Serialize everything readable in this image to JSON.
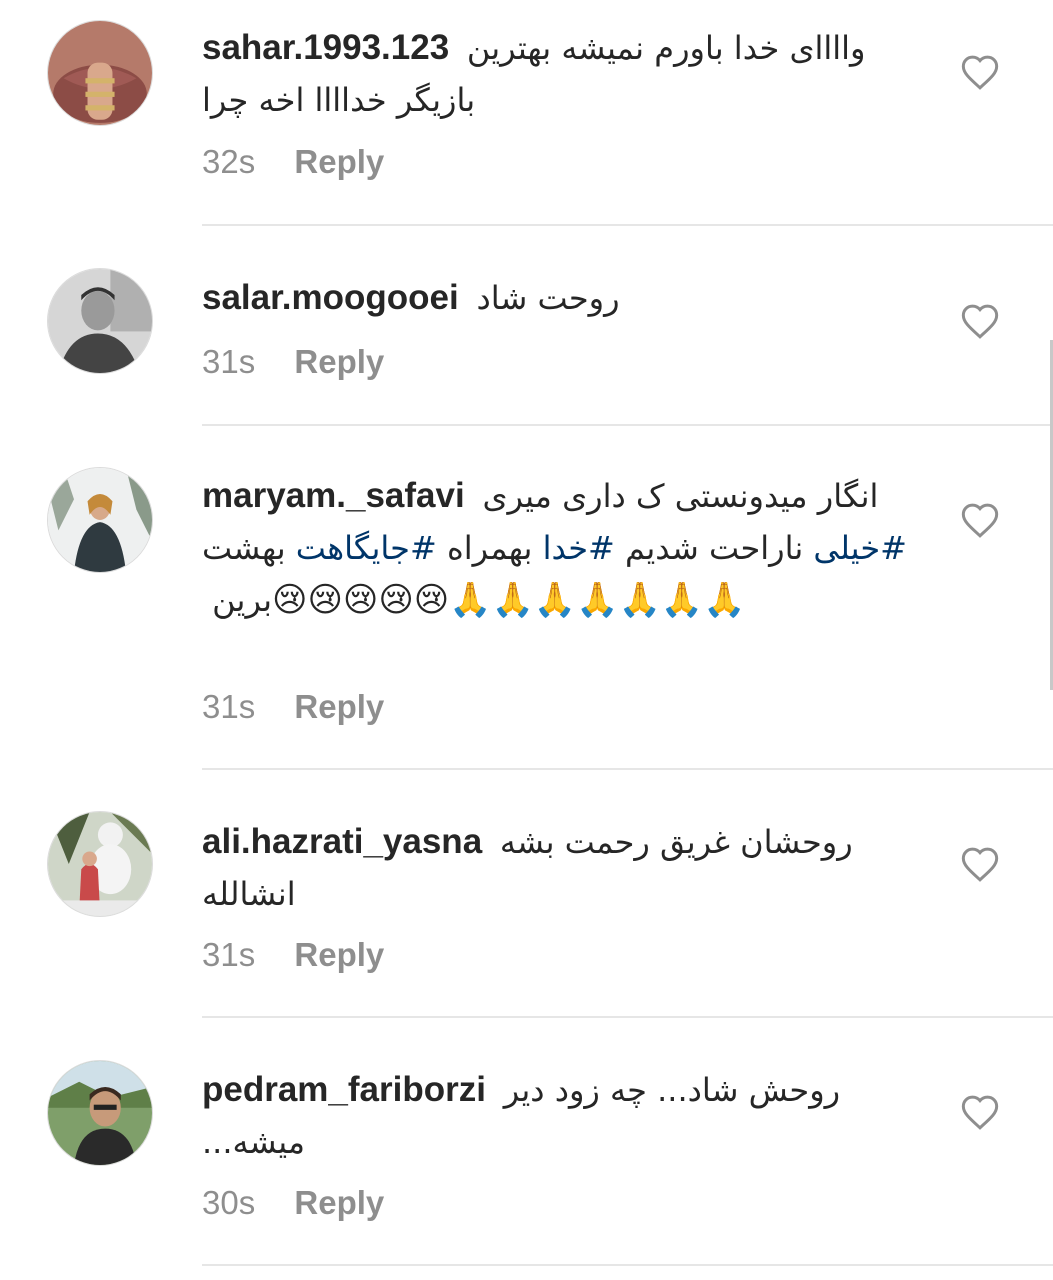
{
  "comments": [
    {
      "username": "sahar.1993.123",
      "text": "واااای خدا باورم نمیشه بهترین بازیگر خداااا اخه چرا",
      "time": "32s",
      "reply_label": "Reply"
    },
    {
      "username": "salar.moogooei",
      "text": "روحت شاد",
      "time": "31s",
      "reply_label": "Reply"
    },
    {
      "username": "maryam._safavi",
      "text_part1": "انگار میدونستی ک داری میری",
      "hashtag1": "#خیلی",
      "text_part2": "ناراحت شدیم",
      "hashtag2": "#خدا",
      "text_part3": "بهمراه",
      "hashtag3": "#جایگاهت",
      "text_part4": "بهشت برین",
      "emojis": "😢😢😢😢😢🙏🙏🙏🙏🙏🙏🙏",
      "time": "31s",
      "reply_label": "Reply"
    },
    {
      "username": "ali.hazrati_yasna",
      "text": "روحشان غریق رحمت بشه انشالله",
      "time": "31s",
      "reply_label": "Reply"
    },
    {
      "username": "pedram_fariborzi",
      "text": "روحش شاد... چه زود دیر میشه...",
      "time": "30s",
      "reply_label": "Reply"
    }
  ],
  "icons": {
    "like": "heart-outline-icon"
  },
  "colors": {
    "username": "#262626",
    "meta": "#8e8e8e",
    "hashtag": "#003569",
    "divider": "#e6e6e6"
  }
}
